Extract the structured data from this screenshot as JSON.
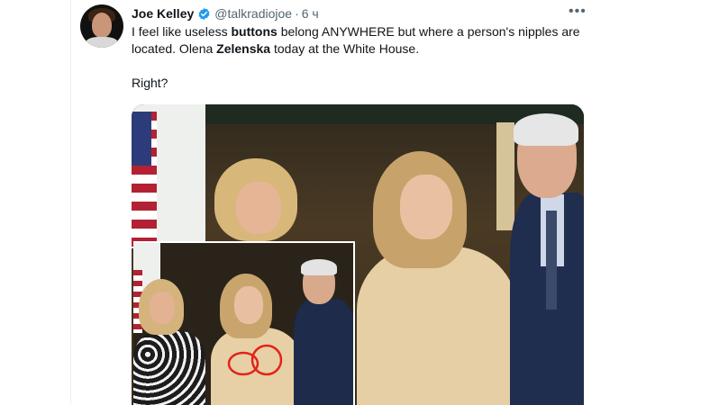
{
  "tweet": {
    "author_name": "Joe Kelley",
    "handle": "@talkradiojoe",
    "separator": "·",
    "time": "6 ч",
    "more_label": "•••",
    "text": {
      "p1_a": "I feel like useless ",
      "p1_b": "buttons",
      "p1_c": " belong ANYWHERE but where a person's nipples are located. Olena ",
      "p1_d": "Zelenska",
      "p1_e": " today at the White House.",
      "p2": "Right?"
    }
  },
  "colors": {
    "verified_badge": "#1d9bf0",
    "secondary_text": "#536471",
    "annotation_red": "#e0241b"
  },
  "icons": {
    "verified": "verified-badge-icon",
    "more": "more-icon"
  }
}
